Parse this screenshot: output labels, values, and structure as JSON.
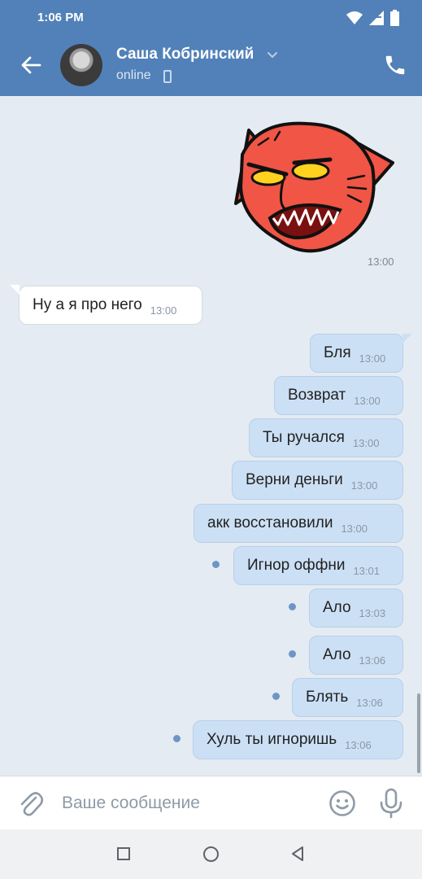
{
  "status_bar": {
    "time": "1:06 PM"
  },
  "header": {
    "contact_name": "Саша Кобринский",
    "presence": "online"
  },
  "messages": [
    {
      "side": "in",
      "text": "Ну а я про него",
      "time": "13:00"
    },
    {
      "side": "out",
      "text": "Бля",
      "time": "13:00"
    },
    {
      "side": "out",
      "text": "Возврат",
      "time": "13:00"
    },
    {
      "side": "out",
      "text": "Ты ручался",
      "time": "13:00"
    },
    {
      "side": "out",
      "text": "Верни деньги",
      "time": "13:00"
    },
    {
      "side": "out",
      "text": "акк восстановили",
      "time": "13:00"
    },
    {
      "side": "out",
      "text": "Игнор оффни",
      "time": "13:01",
      "unread": true
    },
    {
      "side": "out",
      "text": "Ало",
      "time": "13:03",
      "unread": true
    },
    {
      "side": "out",
      "text": "Ало",
      "time": "13:06",
      "unread": true
    },
    {
      "side": "out",
      "text": "Блять",
      "time": "13:06",
      "unread": true
    },
    {
      "side": "out",
      "text": "Хуль ты игноришь",
      "time": "13:06",
      "unread": true
    }
  ],
  "sticker": {
    "time": "13:00",
    "icon": "angry-cat-sticker"
  },
  "composer": {
    "placeholder": "Ваше сообщение"
  },
  "icons": {
    "back": "arrow-left-icon",
    "call": "phone-icon",
    "attach": "paperclip-icon",
    "emoji": "smile-icon",
    "mic": "microphone-icon"
  },
  "colors": {
    "header": "#5181b8",
    "chat_background": "#e5ebf2",
    "outgoing_bubble": "#cce0f5",
    "incoming_bubble": "#ffffff",
    "unread_dot": "#6d96c6"
  }
}
